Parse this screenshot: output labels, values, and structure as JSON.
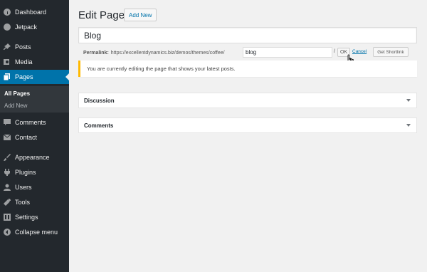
{
  "sidebar": {
    "items": [
      {
        "label": "Dashboard",
        "icon": "dashboard-icon"
      },
      {
        "label": "Jetpack",
        "icon": "jetpack-icon"
      },
      {
        "label": "Posts",
        "icon": "pin-icon"
      },
      {
        "label": "Media",
        "icon": "media-icon"
      },
      {
        "label": "Pages",
        "icon": "pages-icon"
      },
      {
        "label": "Comments",
        "icon": "comment-icon"
      },
      {
        "label": "Contact",
        "icon": "envelope-icon"
      },
      {
        "label": "Appearance",
        "icon": "brush-icon"
      },
      {
        "label": "Plugins",
        "icon": "plug-icon"
      },
      {
        "label": "Users",
        "icon": "user-icon"
      },
      {
        "label": "Tools",
        "icon": "wrench-icon"
      },
      {
        "label": "Settings",
        "icon": "settings-icon"
      },
      {
        "label": "Collapse menu",
        "icon": "collapse-icon"
      }
    ],
    "submenu": [
      {
        "label": "All Pages"
      },
      {
        "label": "Add New"
      }
    ],
    "current": "Pages",
    "colors": {
      "bg": "#23282d",
      "current": "#0073aa",
      "submenu_bg": "#32373c"
    }
  },
  "header": {
    "title": "Edit Page",
    "add_new_label": "Add New"
  },
  "editor": {
    "title_value": "Blog",
    "permalink_label": "Permalink:",
    "permalink_base": "https://excellentdynamics.biz/demos/themes/coffee/",
    "slug_value": "blog",
    "slash": "/",
    "ok_label": "OK",
    "cancel_label": "Cancel",
    "shortlink_label": "Get Shortlink"
  },
  "notice": {
    "text": "You are currently editing the page that shows your latest posts.",
    "color": "#ffb900"
  },
  "postboxes": [
    {
      "title": "Discussion"
    },
    {
      "title": "Comments"
    }
  ]
}
